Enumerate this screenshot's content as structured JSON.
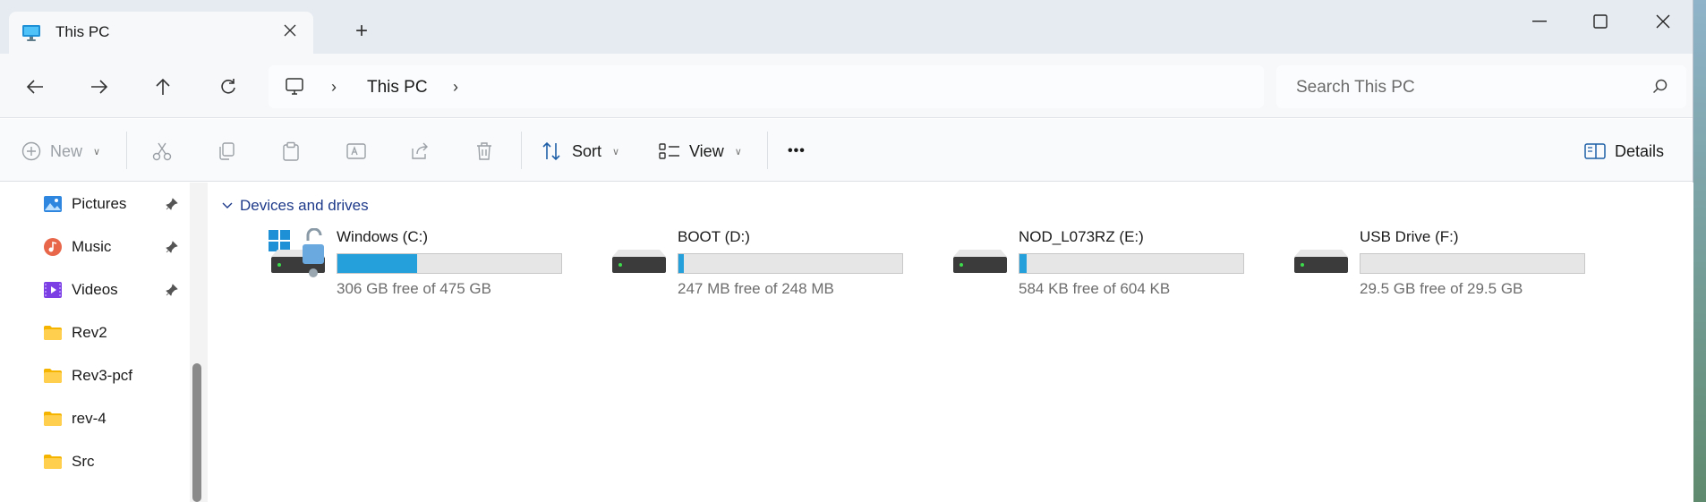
{
  "window": {
    "tab_title": "This PC",
    "new_tab_label": "+"
  },
  "nav": {
    "breadcrumb_root": "This PC",
    "search_placeholder": "Search This PC"
  },
  "commands": {
    "new_label": "New",
    "sort_label": "Sort",
    "view_label": "View",
    "more_label": "•••",
    "details_label": "Details"
  },
  "sidebar": {
    "items": [
      {
        "label": "Pictures",
        "icon": "pictures-icon",
        "pinned": true
      },
      {
        "label": "Music",
        "icon": "music-icon",
        "pinned": true
      },
      {
        "label": "Videos",
        "icon": "videos-icon",
        "pinned": true
      },
      {
        "label": "Rev2",
        "icon": "folder-icon",
        "pinned": false
      },
      {
        "label": "Rev3-pcf",
        "icon": "folder-icon",
        "pinned": false
      },
      {
        "label": "rev-4",
        "icon": "folder-icon",
        "pinned": false
      },
      {
        "label": "Src",
        "icon": "folder-icon",
        "pinned": false
      }
    ]
  },
  "content": {
    "group_title": "Devices and drives",
    "drives": [
      {
        "name": "Windows (C:)",
        "free_text": "306 GB free of 475 GB",
        "used_fraction": 0.356,
        "icon": "windows-drive-unlocked-icon"
      },
      {
        "name": "BOOT (D:)",
        "free_text": "247 MB free of 248 MB",
        "used_fraction": 0.004,
        "icon": "drive-icon"
      },
      {
        "name": "NOD_L073RZ (E:)",
        "free_text": "584 KB free of 604 KB",
        "used_fraction": 0.033,
        "icon": "drive-icon"
      },
      {
        "name": "USB Drive (F:)",
        "free_text": "29.5 GB free of 29.5 GB",
        "used_fraction": 0.0,
        "icon": "drive-icon"
      }
    ]
  },
  "colors": {
    "accent": "#26a0da",
    "group_header": "#1e3a8a"
  }
}
